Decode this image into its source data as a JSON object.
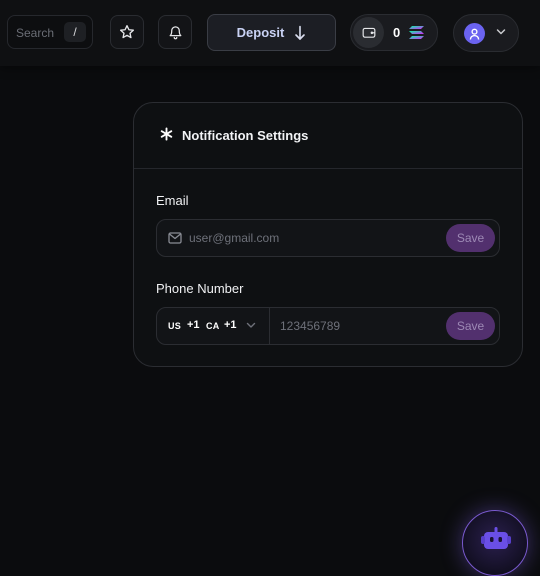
{
  "header": {
    "search": {
      "placeholder": "Search",
      "shortcut": "/"
    },
    "favorites_icon": "star-icon",
    "notifications_icon": "bell-icon",
    "deposit": {
      "label": "Deposit",
      "icon": "arrow-down-icon"
    },
    "wallet": {
      "balance": "0",
      "currency_icon": "solana-icon"
    },
    "user_menu": {
      "avatar_icon": "user-icon",
      "chevron_icon": "chevron-down-icon"
    }
  },
  "notification_settings": {
    "title": "Notification Settings",
    "title_icon": "asterisk-icon",
    "email": {
      "label": "Email",
      "placeholder": "user@gmail.com",
      "save_label": "Save"
    },
    "phone": {
      "label": "Phone Number",
      "countries": [
        {
          "code": "US",
          "dial": "+1"
        },
        {
          "code": "CA",
          "dial": "+1"
        }
      ],
      "placeholder": "123456789",
      "save_label": "Save"
    }
  },
  "assistant_fab": {
    "icon": "robot-icon"
  },
  "colors": {
    "background": "#0b0c0e",
    "card": "#0e1012",
    "save_button": "#52306e",
    "avatar": "#6b63f0",
    "accent_glow": "#7a5ad0"
  }
}
